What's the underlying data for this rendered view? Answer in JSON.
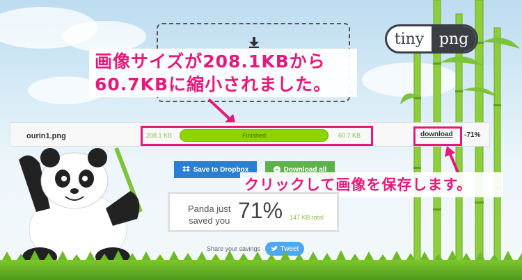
{
  "logo": {
    "part1": "tiny",
    "part2": "png"
  },
  "callout_top": {
    "line1": "画像サイズが208.1KBから",
    "line2": "60.7KBに縮小されました。"
  },
  "callout_bottom": "クリックして画像を保存します。",
  "result": {
    "filename": "ourin1.png",
    "original_size": "208.1 KB",
    "status": "Finished",
    "progress": 1.0,
    "new_size": "60.7 KB",
    "download_label": "download",
    "reduction": "-71%"
  },
  "buttons": {
    "dropbox": "Save to Dropbox",
    "download_all": "Download all"
  },
  "savings": {
    "line1": "Panda just",
    "line2": "saved you",
    "percent": "71%",
    "total": "147 KB total"
  },
  "share": {
    "label": "Share your savings",
    "tweet": "Tweet"
  },
  "colors": {
    "accent": "#e6197a",
    "progress": "#8fd400",
    "dropbox": "#2a7fd0",
    "download_all": "#5fb24a",
    "twitter": "#4da8ef"
  }
}
